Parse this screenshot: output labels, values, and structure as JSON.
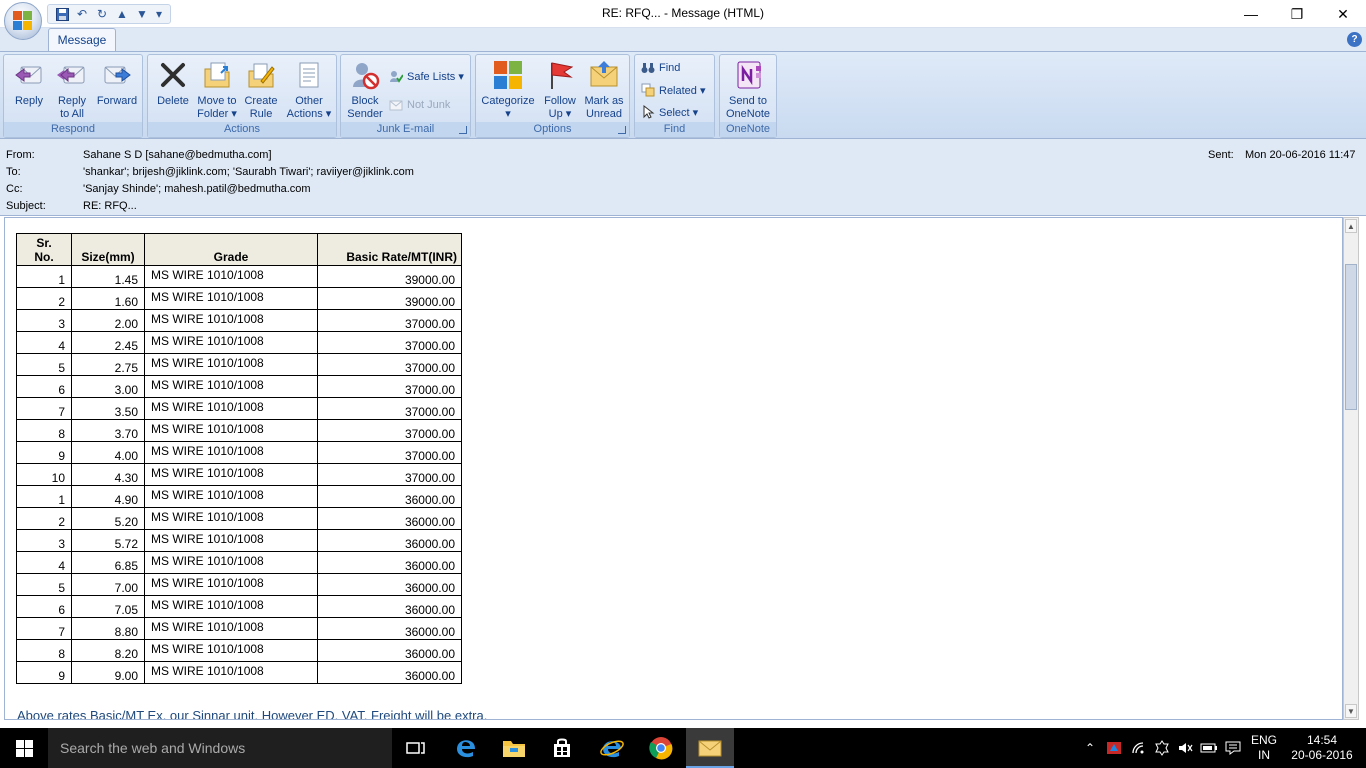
{
  "window": {
    "title": "RE: RFQ... - Message (HTML)",
    "minimize": "—",
    "maximize": "❐",
    "close": "✕"
  },
  "ribbon": {
    "tab": "Message",
    "help": "?",
    "groups": {
      "respond": "Respond",
      "actions": "Actions",
      "junk": "Junk E-mail",
      "options": "Options",
      "find": "Find",
      "onenote": "OneNote"
    },
    "buttons": {
      "reply": "Reply",
      "reply_all_1": "Reply",
      "reply_all_2": "to All",
      "forward": "Forward",
      "delete": "Delete",
      "move_1": "Move to",
      "move_2": "Folder ▾",
      "create_1": "Create",
      "create_2": "Rule",
      "other_1": "Other",
      "other_2": "Actions ▾",
      "block_1": "Block",
      "block_2": "Sender",
      "safe_lists": "Safe Lists ▾",
      "not_junk": "Not Junk",
      "categorize_1": "Categorize",
      "categorize_2": "▾",
      "follow_1": "Follow",
      "follow_2": "Up ▾",
      "mark_1": "Mark as",
      "mark_2": "Unread",
      "find": "Find",
      "related": "Related ▾",
      "select": "Select ▾",
      "send_1": "Send to",
      "send_2": "OneNote"
    }
  },
  "header": {
    "from_label": "From:",
    "from": "Sahane S D  [sahane@bedmutha.com]",
    "to_label": "To:",
    "to": "'shankar'; brijesh@jiklink.com; 'Saurabh Tiwari'; raviiyer@jiklink.com",
    "cc_label": "Cc:",
    "cc": "'Sanjay Shinde'; mahesh.patil@bedmutha.com",
    "subject_label": "Subject:",
    "subject": "RE: RFQ...",
    "sent_label": "Sent:",
    "sent": "Mon 20-06-2016 11:47"
  },
  "table": {
    "headers": {
      "sr_1": "Sr.",
      "sr_2": "No.",
      "size": "Size(mm)",
      "grade": "Grade",
      "rate": "Basic Rate/MT(INR)"
    },
    "rows": [
      {
        "sr": "1",
        "size": "1.45",
        "grade": "MS WIRE 1010/1008",
        "rate": "39000.00"
      },
      {
        "sr": "2",
        "size": "1.60",
        "grade": "MS WIRE 1010/1008",
        "rate": "39000.00"
      },
      {
        "sr": "3",
        "size": "2.00",
        "grade": "MS WIRE 1010/1008",
        "rate": "37000.00"
      },
      {
        "sr": "4",
        "size": "2.45",
        "grade": "MS WIRE 1010/1008",
        "rate": "37000.00"
      },
      {
        "sr": "5",
        "size": "2.75",
        "grade": "MS WIRE 1010/1008",
        "rate": "37000.00"
      },
      {
        "sr": "6",
        "size": "3.00",
        "grade": "MS WIRE 1010/1008",
        "rate": "37000.00"
      },
      {
        "sr": "7",
        "size": "3.50",
        "grade": "MS WIRE 1010/1008",
        "rate": "37000.00"
      },
      {
        "sr": "8",
        "size": "3.70",
        "grade": "MS WIRE 1010/1008",
        "rate": "37000.00"
      },
      {
        "sr": "9",
        "size": "4.00",
        "grade": "MS WIRE 1010/1008",
        "rate": "37000.00"
      },
      {
        "sr": "10",
        "size": "4.30",
        "grade": "MS WIRE 1010/1008",
        "rate": "37000.00"
      },
      {
        "sr": "1",
        "size": "4.90",
        "grade": "MS WIRE 1010/1008",
        "rate": "36000.00"
      },
      {
        "sr": "2",
        "size": "5.20",
        "grade": "MS WIRE 1010/1008",
        "rate": "36000.00"
      },
      {
        "sr": "3",
        "size": "5.72",
        "grade": "MS WIRE 1010/1008",
        "rate": "36000.00"
      },
      {
        "sr": "4",
        "size": "6.85",
        "grade": "MS WIRE 1010/1008",
        "rate": "36000.00"
      },
      {
        "sr": "5",
        "size": "7.00",
        "grade": "MS WIRE 1010/1008",
        "rate": "36000.00"
      },
      {
        "sr": "6",
        "size": "7.05",
        "grade": "MS WIRE 1010/1008",
        "rate": "36000.00"
      },
      {
        "sr": "7",
        "size": "8.80",
        "grade": "MS WIRE 1010/1008",
        "rate": "36000.00"
      },
      {
        "sr": "8",
        "size": "8.20",
        "grade": "MS WIRE 1010/1008",
        "rate": "36000.00"
      },
      {
        "sr": "9",
        "size": "9.00",
        "grade": "MS WIRE 1010/1008",
        "rate": "36000.00"
      }
    ]
  },
  "note": "Above rates Basic/MT Ex. our Sinnar unit. However ED, VAT, Freight will be extra.",
  "taskbar": {
    "search_placeholder": "Search the web and Windows",
    "lang_1": "ENG",
    "lang_2": "IN",
    "time": "14:54",
    "date": "20-06-2016"
  },
  "colors": {
    "ribbon_text": "#15428b",
    "table_header_bg": "#eeece1",
    "note_text": "#1f497d"
  }
}
